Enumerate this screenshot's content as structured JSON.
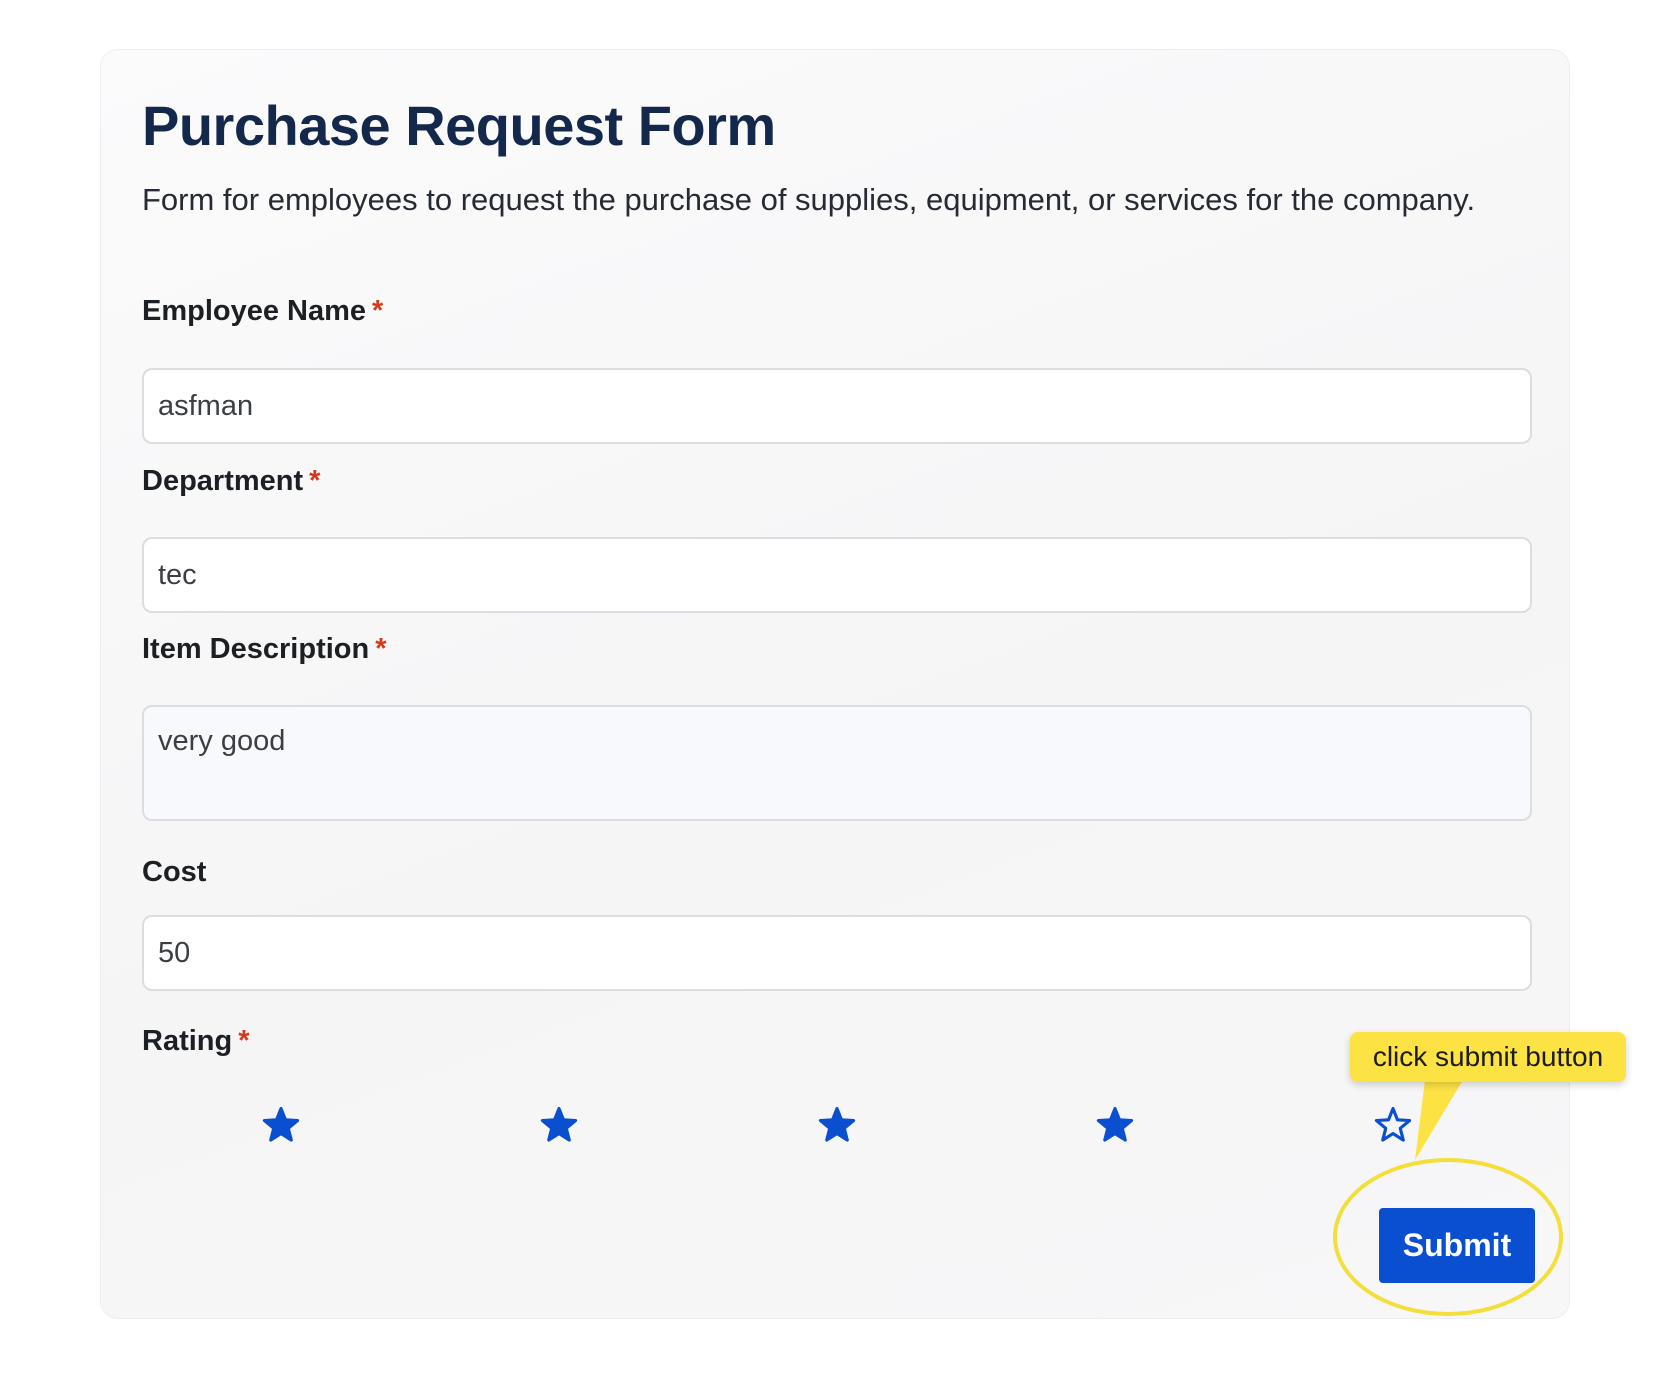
{
  "form": {
    "title": "Purchase Request Form",
    "description": "Form for employees to request the purchase of supplies, equipment, or services for the company."
  },
  "fields": {
    "employee_name": {
      "label": "Employee Name",
      "required_mark": "*",
      "value": "asfman"
    },
    "department": {
      "label": "Department",
      "required_mark": "*",
      "value": "tec"
    },
    "item_description": {
      "label": "Item Description",
      "required_mark": "*",
      "value": "very good"
    },
    "cost": {
      "label": "Cost",
      "value": "50"
    },
    "rating": {
      "label": "Rating",
      "required_mark": "*",
      "value": 4,
      "max": 5
    }
  },
  "submit": {
    "label": "Submit"
  },
  "annotation": {
    "text": "click submit button"
  },
  "colors": {
    "accent": "#0b4fd1",
    "title": "#14284b",
    "required": "#d23a1a",
    "highlight": "#f3de3a",
    "callout_bg": "#fde244"
  },
  "icons": {
    "rating_star": "star-icon"
  }
}
